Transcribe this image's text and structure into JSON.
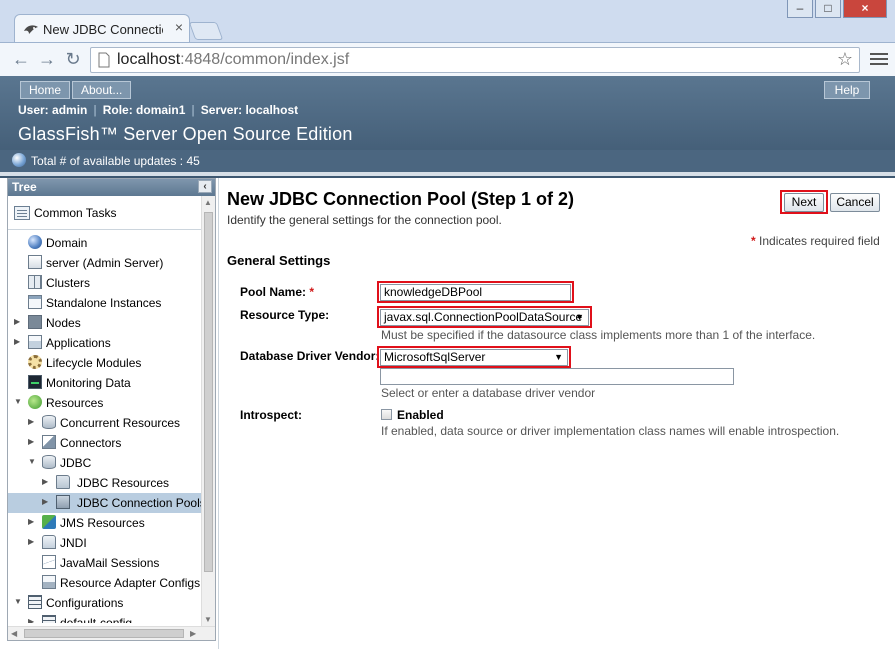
{
  "browser": {
    "tab_title": "New JDBC Connection P",
    "url_host": "localhost",
    "url_rest": ":4848/common/index.jsf"
  },
  "header": {
    "home_label": "Home",
    "about_label": "About...",
    "help_label": "Help",
    "user_text": "User: admin",
    "role_text": "Role: domain1",
    "server_text": "Server: localhost",
    "product_title": "GlassFish™ Server Open Source Edition",
    "updates_text": "Total # of available updates : 45"
  },
  "tree": {
    "title": "Tree",
    "common_tasks": "Common Tasks",
    "items": [
      {
        "label": "Domain",
        "icon": "globe-icon"
      },
      {
        "label": "server (Admin Server)",
        "icon": "server-icon"
      },
      {
        "label": "Clusters",
        "icon": "cluster-icon"
      },
      {
        "label": "Standalone Instances",
        "icon": "window-icon"
      },
      {
        "label": "Nodes",
        "icon": "node-icon"
      },
      {
        "label": "Applications",
        "icon": "applications-icon"
      },
      {
        "label": "Lifecycle Modules",
        "icon": "gear-icon"
      },
      {
        "label": "Monitoring Data",
        "icon": "monitor-icon"
      },
      {
        "label": "Resources",
        "icon": "resources-icon"
      },
      {
        "label": "Concurrent Resources",
        "icon": "database-icon"
      },
      {
        "label": "Connectors",
        "icon": "connector-icon"
      },
      {
        "label": "JDBC",
        "icon": "database-icon"
      },
      {
        "label": "JDBC Resources",
        "icon": "folder-icon"
      },
      {
        "label": "JDBC Connection Pools",
        "icon": "folder-open-icon"
      },
      {
        "label": "JMS Resources",
        "icon": "jms-icon"
      },
      {
        "label": "JNDI",
        "icon": "jndi-icon"
      },
      {
        "label": "JavaMail Sessions",
        "icon": "mail-icon"
      },
      {
        "label": "Resource Adapter Configs",
        "icon": "adapter-icon"
      },
      {
        "label": "Configurations",
        "icon": "config-icon"
      },
      {
        "label": "default-config",
        "icon": "config-icon"
      }
    ]
  },
  "main": {
    "title": "New JDBC Connection Pool (Step 1 of 2)",
    "help_text": "Identify the general settings for the connection pool.",
    "next_label": "Next",
    "cancel_label": "Cancel",
    "required_legend": "Indicates required field",
    "required_star": "*",
    "section_title": "General Settings",
    "pool_name_label": "Pool Name:",
    "pool_name_value": "knowledgeDBPool",
    "resource_type_label": "Resource Type:",
    "resource_type_value": "javax.sql.ConnectionPoolDataSource",
    "resource_type_hint": "Must be specified if the datasource class implements more than 1 of the interface.",
    "vendor_label": "Database Driver Vendor:",
    "vendor_value": "MicrosoftSqlServer",
    "vendor_input_value": "",
    "vendor_hint": "Select or enter a database driver vendor",
    "introspect_label": "Introspect:",
    "introspect_checkbox_label": "Enabled",
    "introspect_hint": "If enabled, data source or driver implementation class names will enable introspection."
  }
}
